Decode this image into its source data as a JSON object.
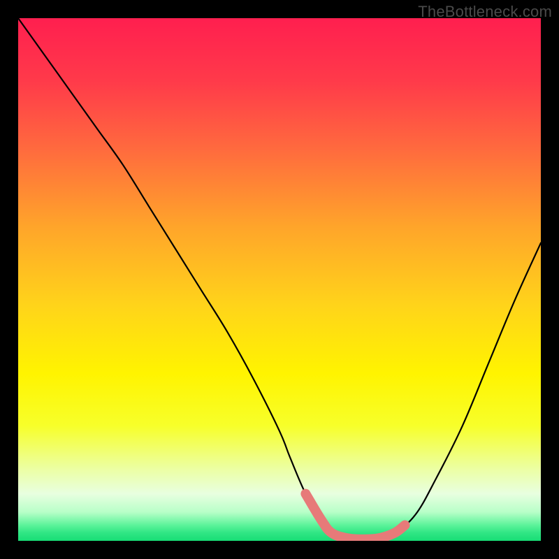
{
  "watermark": "TheBottleneck.com",
  "colors": {
    "black": "#000000",
    "curve_stroke": "#000000",
    "highlight_stroke": "#e77a79",
    "watermark_color": "#4a4a4a"
  },
  "gradient_stops": [
    {
      "offset": 0.0,
      "color": "#ff1f4f"
    },
    {
      "offset": 0.12,
      "color": "#ff3a4a"
    },
    {
      "offset": 0.25,
      "color": "#ff6a3e"
    },
    {
      "offset": 0.4,
      "color": "#ffa52a"
    },
    {
      "offset": 0.55,
      "color": "#ffd41a"
    },
    {
      "offset": 0.68,
      "color": "#fff400"
    },
    {
      "offset": 0.78,
      "color": "#f7ff2a"
    },
    {
      "offset": 0.86,
      "color": "#ecffa0"
    },
    {
      "offset": 0.91,
      "color": "#e8ffe0"
    },
    {
      "offset": 0.945,
      "color": "#b8ffc8"
    },
    {
      "offset": 0.97,
      "color": "#5cf39a"
    },
    {
      "offset": 0.985,
      "color": "#2fe684"
    },
    {
      "offset": 1.0,
      "color": "#18dd75"
    }
  ],
  "chart_data": {
    "type": "line",
    "title": "",
    "xlabel": "",
    "ylabel": "",
    "xlim": [
      0,
      100
    ],
    "ylim": [
      0,
      100
    ],
    "series": [
      {
        "name": "bottleneck-curve",
        "x": [
          0,
          5,
          10,
          15,
          20,
          25,
          30,
          35,
          40,
          45,
          50,
          52,
          55,
          58,
          60,
          63,
          66,
          69,
          72,
          76,
          80,
          85,
          90,
          95,
          100
        ],
        "y": [
          100,
          93,
          86,
          79,
          72,
          64,
          56,
          48,
          40,
          31,
          21,
          16,
          9,
          4,
          1.5,
          0.5,
          0.3,
          0.5,
          1.5,
          5,
          12,
          22,
          34,
          46,
          57
        ]
      },
      {
        "name": "highlight-segment",
        "x": [
          55,
          58,
          60,
          63,
          66,
          69,
          72,
          74
        ],
        "y": [
          9,
          4,
          1.5,
          0.5,
          0.3,
          0.5,
          1.5,
          3
        ]
      }
    ]
  }
}
